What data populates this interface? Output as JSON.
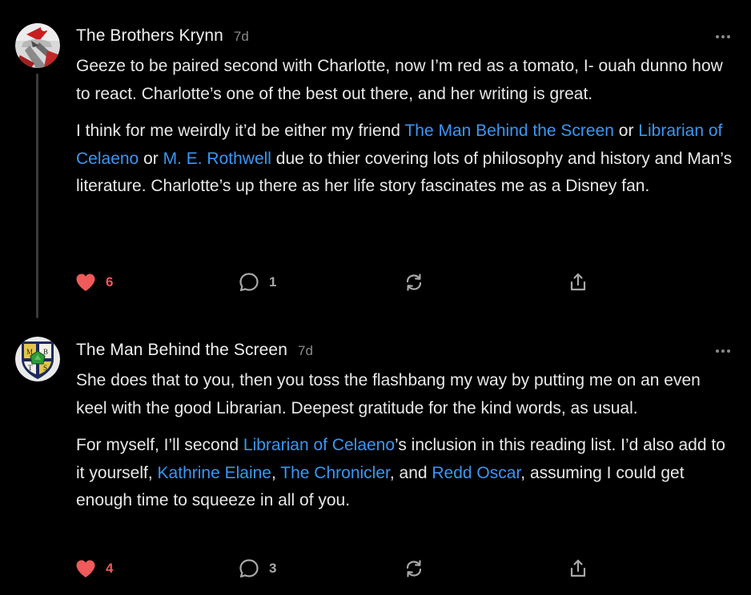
{
  "comments": [
    {
      "author": "The Brothers Krynn",
      "age": "7d",
      "avatar": "red-hat-warrior-avatar",
      "paragraphs": [
        [
          {
            "text": "Geeze to be paired second with Charlotte, now I’m red as a tomato, I- ouah dunno how to react. Charlotte’s one of the best out there, and her writing is great.",
            "link": false
          }
        ],
        [
          {
            "text": "I think for me weirdly it’d be either my friend ",
            "link": false
          },
          {
            "text": "The Man Behind the Screen",
            "link": true
          },
          {
            "text": " or ",
            "link": false
          },
          {
            "text": "Librarian of Celaeno",
            "link": true
          },
          {
            "text": " or ",
            "link": false
          },
          {
            "text": "M. E. Rothwell",
            "link": true
          },
          {
            "text": " due to thier covering lots of philosophy and history and Man’s literature. Charlotte’s up there as her life story fascinates me as a Disney fan.",
            "link": false
          }
        ]
      ],
      "likes": "6",
      "replies": "1"
    },
    {
      "author": "The Man Behind the Screen",
      "age": "7d",
      "avatar": "mbts-shield-avatar",
      "avatar_letters": [
        "M",
        "B",
        "T",
        "S"
      ],
      "paragraphs": [
        [
          {
            "text": "She does that to you, then you toss the flashbang my way by putting me on an even keel with the good Librarian. Deepest gratitude for the kind words, as usual.",
            "link": false
          }
        ],
        [
          {
            "text": "For myself, I’ll second ",
            "link": false
          },
          {
            "text": "Librarian of Celaeno",
            "link": true
          },
          {
            "text": "’s inclusion in this reading list. I’d also add to it yourself, ",
            "link": false
          },
          {
            "text": "Kathrine Elaine",
            "link": true
          },
          {
            "text": ", ",
            "link": false
          },
          {
            "text": "The Chronicler",
            "link": true
          },
          {
            "text": ", and ",
            "link": false
          },
          {
            "text": "Redd Oscar",
            "link": true
          },
          {
            "text": ", assuming I could get enough time to squeeze in all of you.",
            "link": false
          }
        ]
      ],
      "likes": "4",
      "replies": "3"
    }
  ],
  "colors": {
    "background": "#000000",
    "text": "#e8e8e8",
    "muted": "#8a8a8a",
    "link": "#3b96f3",
    "heart": "#ef5a5a"
  },
  "icons": {
    "like": "heart-icon",
    "reply": "speech-bubble-icon",
    "restack": "restack-icon",
    "share": "share-icon",
    "more": "more-dots-icon"
  }
}
